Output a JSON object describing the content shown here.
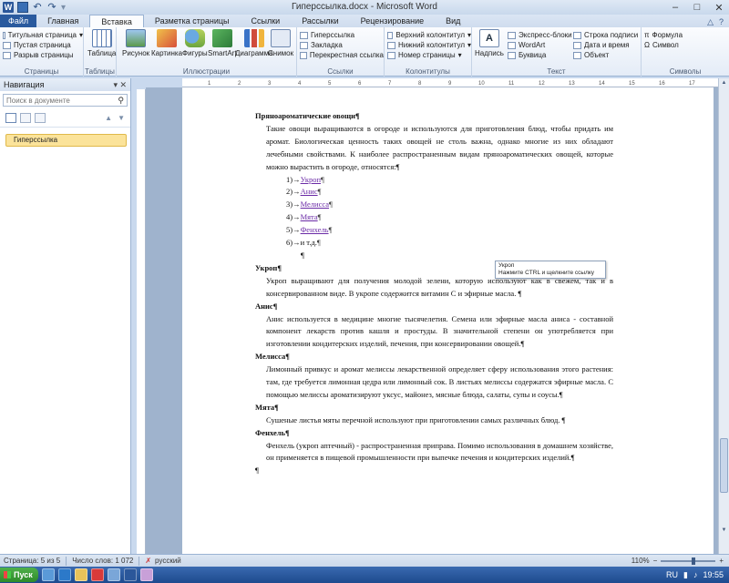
{
  "window": {
    "title": "Гиперссылка.docx - Microsoft Word",
    "controls": [
      "–",
      "□",
      "✕"
    ]
  },
  "tabs": {
    "file": "Файл",
    "items": [
      "Главная",
      "Вставка",
      "Разметка страницы",
      "Ссылки",
      "Рассылки",
      "Рецензирование",
      "Вид"
    ],
    "active": "Вставка"
  },
  "ribbon": {
    "pages": {
      "items": [
        "Титульная страница",
        "Пустая страница",
        "Разрыв страницы"
      ],
      "label": "Страницы"
    },
    "tables": {
      "button": "Таблица",
      "label": "Таблицы"
    },
    "illustrations": {
      "buttons": [
        "Рисунок",
        "Картинка",
        "Фигуры",
        "SmartArt",
        "Диаграмма",
        "Снимок"
      ],
      "label": "Иллюстрации"
    },
    "links": {
      "items": [
        "Гиперссылка",
        "Закладка",
        "Перекрестная ссылка"
      ],
      "label": "Ссылки"
    },
    "headerfooter": {
      "items": [
        "Верхний колонтитул",
        "Нижний колонтитул",
        "Номер страницы"
      ],
      "label": "Колонтитулы"
    },
    "text": {
      "big": "Надпись",
      "items": [
        "Экспресс-блоки",
        "WordArt",
        "Буквица"
      ],
      "items2": [
        "Строка подписи",
        "Дата и время",
        "Объект"
      ],
      "label": "Текст"
    },
    "symbols": {
      "items": [
        "Формула",
        "Символ"
      ],
      "label": "Символы"
    }
  },
  "nav": {
    "title": "Навигация",
    "search_placeholder": "Поиск в документе",
    "heading": "Гиперссылка"
  },
  "document": {
    "h1": "Пряноароматические овощи¶",
    "p1": "Такие овощи выращиваются в огороде и используются для приготовления блюд, чтобы придать им аромат. Биологическая ценность таких овощей не столь важна, однако многие из них обладают лечебными свойствами. К наиболее распространенным видам пряноароматических овощей, которые можно вырастить в огороде, относятся:¶",
    "list": [
      {
        "num": "1)→",
        "text": "Укроп",
        "link": true
      },
      {
        "num": "2)→",
        "text": "Анис",
        "link": true
      },
      {
        "num": "3)→",
        "text": "Мелисса",
        "link": true
      },
      {
        "num": "4)→",
        "text": "Мята",
        "link": true
      },
      {
        "num": "5)→",
        "text": "Фенхель",
        "link": true
      },
      {
        "num": "6)→",
        "text": "и т.д.",
        "link": false
      }
    ],
    "empty_pm": "¶",
    "sections": [
      {
        "title": "Укроп¶",
        "body": "Укроп выращивают для получения молодой зелени, которую используют как в свежем, так и в консервированном виде. В укропе содержится витамин С и эфирные масла. ¶"
      },
      {
        "title": "Анис¶",
        "body": "Анис используется в медицине многие тысячелетия. Семена или эфирные масла аниса - составной компонент лекарств против кашля и простуды. В значительной степени он употребляется при изготовлении кондитерских изделий, печения, при консервировании овощей.¶"
      },
      {
        "title": "Мелисса¶",
        "body": "Лимонный привкус и аромат мелиссы лекарственной определяет сферу использования этого растения: там, где требуется лимонная цедра или лимонный сок. В листьях мелиссы содержатся эфирные масла. С помощью мелиссы ароматизируют уксус, майонез, мясные блюда, салаты, супы и соусы.¶"
      },
      {
        "title": "Мята¶",
        "body": "Сушеные листья мяты перечной используют при приготовлении самых различных блюд. ¶"
      },
      {
        "title": "Фенхель¶",
        "body": "Фенхель (укроп аптечный) - распространенная приправа. Помимо использования в домашнем хозяйстве, он применяется в пищевой промышленности при выпечке печения и кондитерских изделий.¶"
      }
    ],
    "end_pm": "¶"
  },
  "tooltip": {
    "line1": "Укроп",
    "line2": "Нажмите CTRL и щелкните ссылку"
  },
  "status": {
    "page": "Страница: 5 из 5",
    "words": "Число слов: 1 072",
    "lang": "русский",
    "zoom": "110%"
  },
  "taskbar": {
    "start": "Пуск",
    "lang": "RU",
    "time": "19:55"
  },
  "ruler_ticks": [
    "1",
    "2",
    "3",
    "4",
    "5",
    "6",
    "7",
    "8",
    "9",
    "10",
    "11",
    "12",
    "13",
    "14",
    "15",
    "16",
    "17"
  ]
}
